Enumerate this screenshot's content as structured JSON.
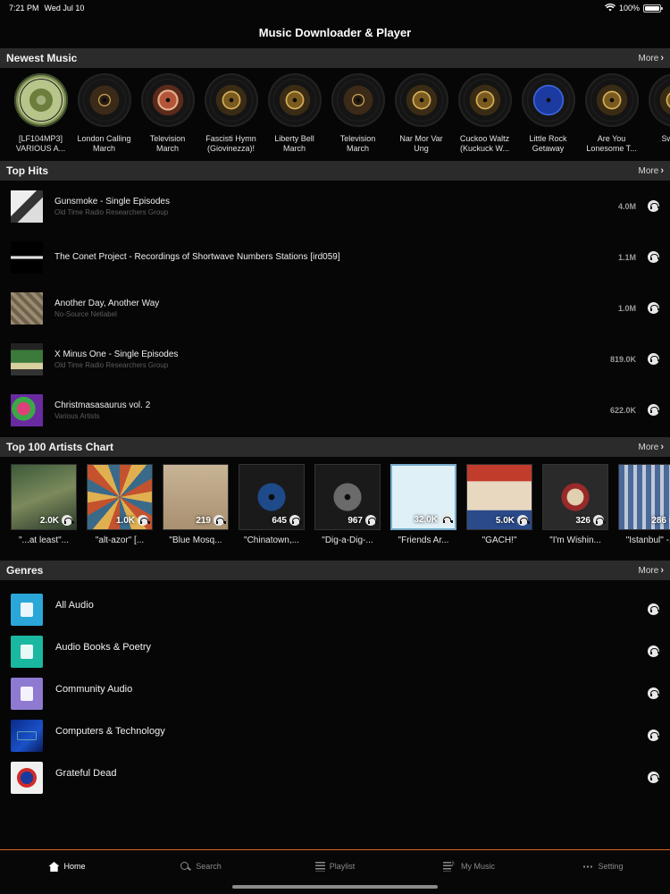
{
  "status_bar": {
    "time": "7:21 PM",
    "date": "Wed Jul 10",
    "battery": "100%"
  },
  "app": {
    "title": "Music Downloader & Player"
  },
  "sections": {
    "newest": {
      "title": "Newest Music",
      "more": "More"
    },
    "top_hits": {
      "title": "Top Hits",
      "more": "More"
    },
    "artists": {
      "title": "Top 100 Artists Chart",
      "more": "More"
    },
    "genres": {
      "title": "Genres",
      "more": "More"
    }
  },
  "newest_music": [
    {
      "label": "[LF104MP3] VARIOUS A..."
    },
    {
      "label": "London Calling March"
    },
    {
      "label": "Television March"
    },
    {
      "label": "Fascisti Hymn (Giovinezza)!"
    },
    {
      "label": "Liberty Bell March"
    },
    {
      "label": "Television March"
    },
    {
      "label": "Nar Mor Var Ung"
    },
    {
      "label": "Cuckoo Waltz (Kuckuck W..."
    },
    {
      "label": "Little Rock Getaway"
    },
    {
      "label": "Are You Lonesome T..."
    },
    {
      "label": "Swee..."
    }
  ],
  "top_hits": [
    {
      "title": "Gunsmoke - Single Episodes",
      "subtitle": "Old Time Radio Researchers Group",
      "count": "4.0M"
    },
    {
      "title": "The Conet Project - Recordings of Shortwave Numbers Stations [ird059]",
      "subtitle": "",
      "count": "1.1M"
    },
    {
      "title": "Another Day, Another Way",
      "subtitle": "No-Source Netlabel",
      "count": "1.0M"
    },
    {
      "title": "X Minus One - Single Episodes",
      "subtitle": "Old Time Radio Researchers Group",
      "count": "819.0K"
    },
    {
      "title": "Christmasasaurus vol. 2",
      "subtitle": "Various Artists",
      "count": "622.0K"
    }
  ],
  "artists": [
    {
      "name": "\"...at least\"...",
      "count": "2.0K"
    },
    {
      "name": "\"alt-azor\" [...",
      "count": "1.0K"
    },
    {
      "name": "\"Blue Mosq...",
      "count": "219"
    },
    {
      "name": "\"Chinatown,...",
      "count": "645"
    },
    {
      "name": "\"Dig-a-Dig-...",
      "count": "967"
    },
    {
      "name": "\"Friends Ar...",
      "count": "32.0K"
    },
    {
      "name": "\"GACH!\"",
      "count": "5.0K"
    },
    {
      "name": "\"I'm Wishin...",
      "count": "326"
    },
    {
      "name": "\"Istanbul\" -...",
      "count": "286"
    }
  ],
  "genres": [
    {
      "label": "All Audio"
    },
    {
      "label": "Audio Books & Poetry"
    },
    {
      "label": "Community Audio"
    },
    {
      "label": "Computers & Technology"
    },
    {
      "label": "Grateful Dead"
    }
  ],
  "tab_bar": {
    "home": "Home",
    "search": "Search",
    "playlist": "Playlist",
    "my_music": "My Music",
    "setting": "Setting"
  },
  "colors": {
    "accent": "#e0622a",
    "section_bg": "#2b2b2b",
    "background": "#060606"
  }
}
